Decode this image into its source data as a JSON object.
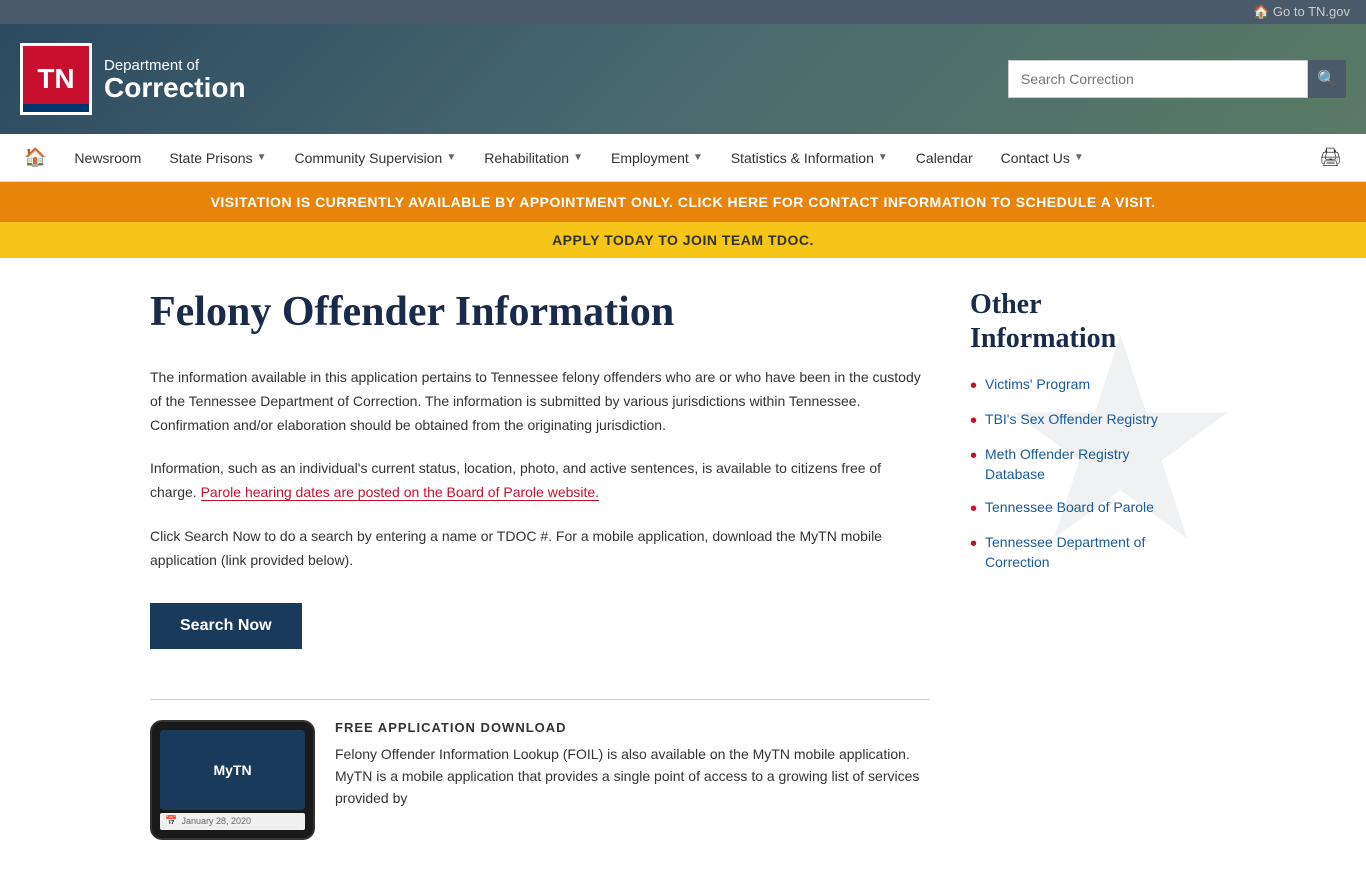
{
  "topbar": {
    "link_label": "🏠 Go to TN.gov"
  },
  "header": {
    "logo_letters": "TN",
    "dept_label": "Department of",
    "correction_label": "Correction",
    "search_placeholder": "Search Correction"
  },
  "nav": {
    "items": [
      {
        "id": "home",
        "label": "🏠",
        "has_dropdown": false
      },
      {
        "id": "newsroom",
        "label": "Newsroom",
        "has_dropdown": false
      },
      {
        "id": "state-prisons",
        "label": "State Prisons",
        "has_dropdown": true
      },
      {
        "id": "community-supervision",
        "label": "Community Supervision",
        "has_dropdown": true
      },
      {
        "id": "rehabilitation",
        "label": "Rehabilitation",
        "has_dropdown": true
      },
      {
        "id": "employment",
        "label": "Employment",
        "has_dropdown": true
      },
      {
        "id": "statistics",
        "label": "Statistics & Information",
        "has_dropdown": true
      },
      {
        "id": "calendar",
        "label": "Calendar",
        "has_dropdown": false
      },
      {
        "id": "contact-us",
        "label": "Contact Us",
        "has_dropdown": true
      },
      {
        "id": "print",
        "label": "🖨",
        "has_dropdown": false
      }
    ]
  },
  "banners": {
    "orange_text": "VISITATION IS CURRENTLY AVAILABLE BY APPOINTMENT ONLY. CLICK HERE FOR CONTACT INFORMATION TO SCHEDULE A VISIT.",
    "yellow_text": "APPLY TODAY TO JOIN TEAM TDOC."
  },
  "main": {
    "page_title": "Felony Offender Information",
    "para1": "The information available in this application pertains to Tennessee felony offenders who are or who have been in the custody of the Tennessee Department of Correction.  The information is submitted by various jurisdictions within Tennessee.  Confirmation and/or elaboration should be obtained from the originating jurisdiction.",
    "para2_start": "Information, such as an individual's current status, location, photo, and active sentences, is available to citizens free of charge.  ",
    "para2_link": "Parole hearing dates are posted on the Board of Parole  website.",
    "para3": "Click Search Now to do a search by entering a name or TDOC #.  For a mobile application, download the MyTN mobile application (link provided below).",
    "search_button": "Search Now",
    "app_label": "FREE APPLICATION DOWNLOAD",
    "app_text": "Felony Offender Information Lookup (FOIL) is also available on the MyTN mobile application.  MyTN is a mobile application that provides a single point of access to a growing list of services provided by",
    "phone_label": "MyTN"
  },
  "sidebar": {
    "title": "Other Information",
    "links": [
      {
        "label": "Victims' Program"
      },
      {
        "label": "TBI's Sex Offender Registry"
      },
      {
        "label": "Meth Offender Registry Database"
      },
      {
        "label": "Tennessee Board of Parole"
      },
      {
        "label": "Tennessee Department of Correction"
      }
    ]
  }
}
